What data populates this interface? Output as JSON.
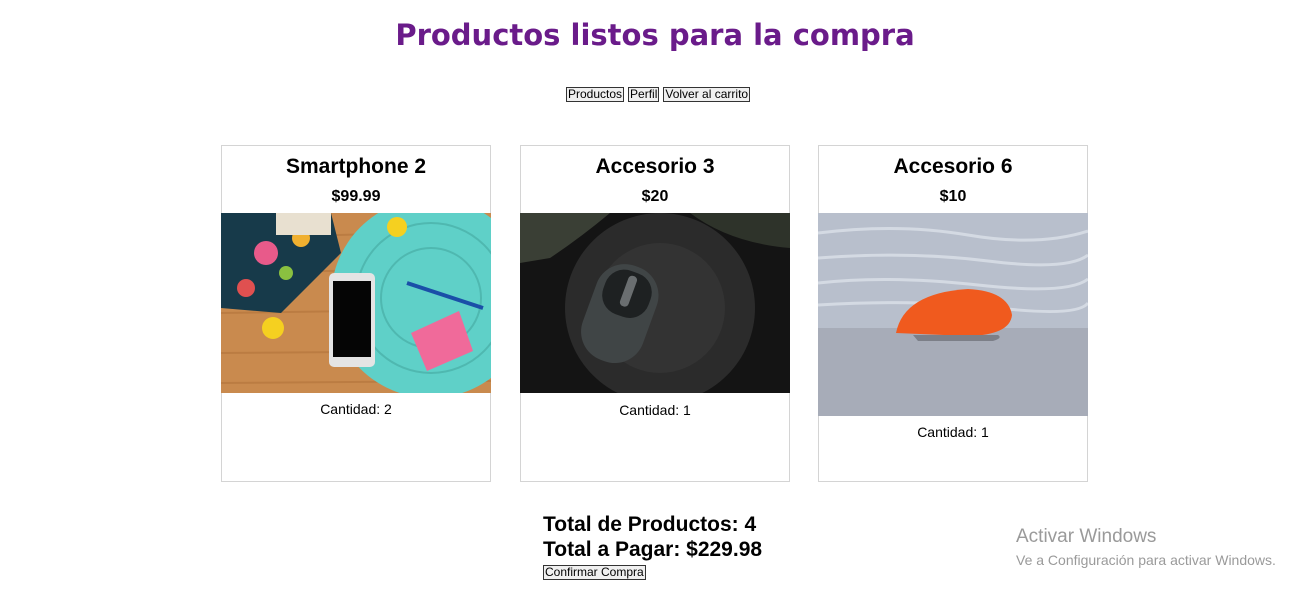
{
  "header": {
    "title": "Productos listos para la compra"
  },
  "nav": {
    "productos_label": "Productos",
    "perfil_label": "Perfil",
    "volver_label": "Volver al carrito"
  },
  "cards": [
    {
      "name": "Smartphone 2",
      "price": "$99.99",
      "quantity_text": "Cantidad: 2",
      "image": "smartphone-on-desk-photo"
    },
    {
      "name": "Accesorio 3",
      "price": "$20",
      "quantity_text": "Cantidad: 1",
      "image": "black-mouse-on-stump-photo"
    },
    {
      "name": "Accesorio 6",
      "price": "$10",
      "quantity_text": "Cantidad: 1",
      "image": "orange-mouse-on-wood-photo"
    }
  ],
  "summary": {
    "total_products": "Total de Productos: 4",
    "total_pay": "Total a Pagar: $229.98",
    "confirm_label": "Confirmar Compra"
  },
  "watermark": {
    "line1": "Activar Windows",
    "line2": "Ve a Configuración para activar Windows."
  },
  "colors": {
    "title": "#6a1b8a",
    "card_border": "#d4d4d4"
  }
}
